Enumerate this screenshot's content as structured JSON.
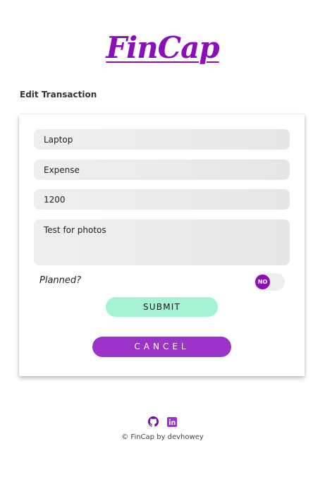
{
  "app": {
    "logo_text": "FinCap",
    "brand_color": "#8a0fb8"
  },
  "page": {
    "section_title": "Edit Transaction"
  },
  "form": {
    "name_value": "Laptop",
    "type_value": "Expense",
    "amount_value": "1200",
    "notes_value": "Test for photos",
    "planned_label": "Planned?",
    "planned_toggle": {
      "state_label": "NO",
      "checked": false
    },
    "submit_label": "SUBMIT",
    "submit_color": "#a6f3d4",
    "cancel_label": "CANCEL",
    "cancel_color": "#9b33c9"
  },
  "footer": {
    "icons": [
      "github-icon",
      "linkedin-icon"
    ],
    "copyright": "© FinCap by devhowey"
  }
}
